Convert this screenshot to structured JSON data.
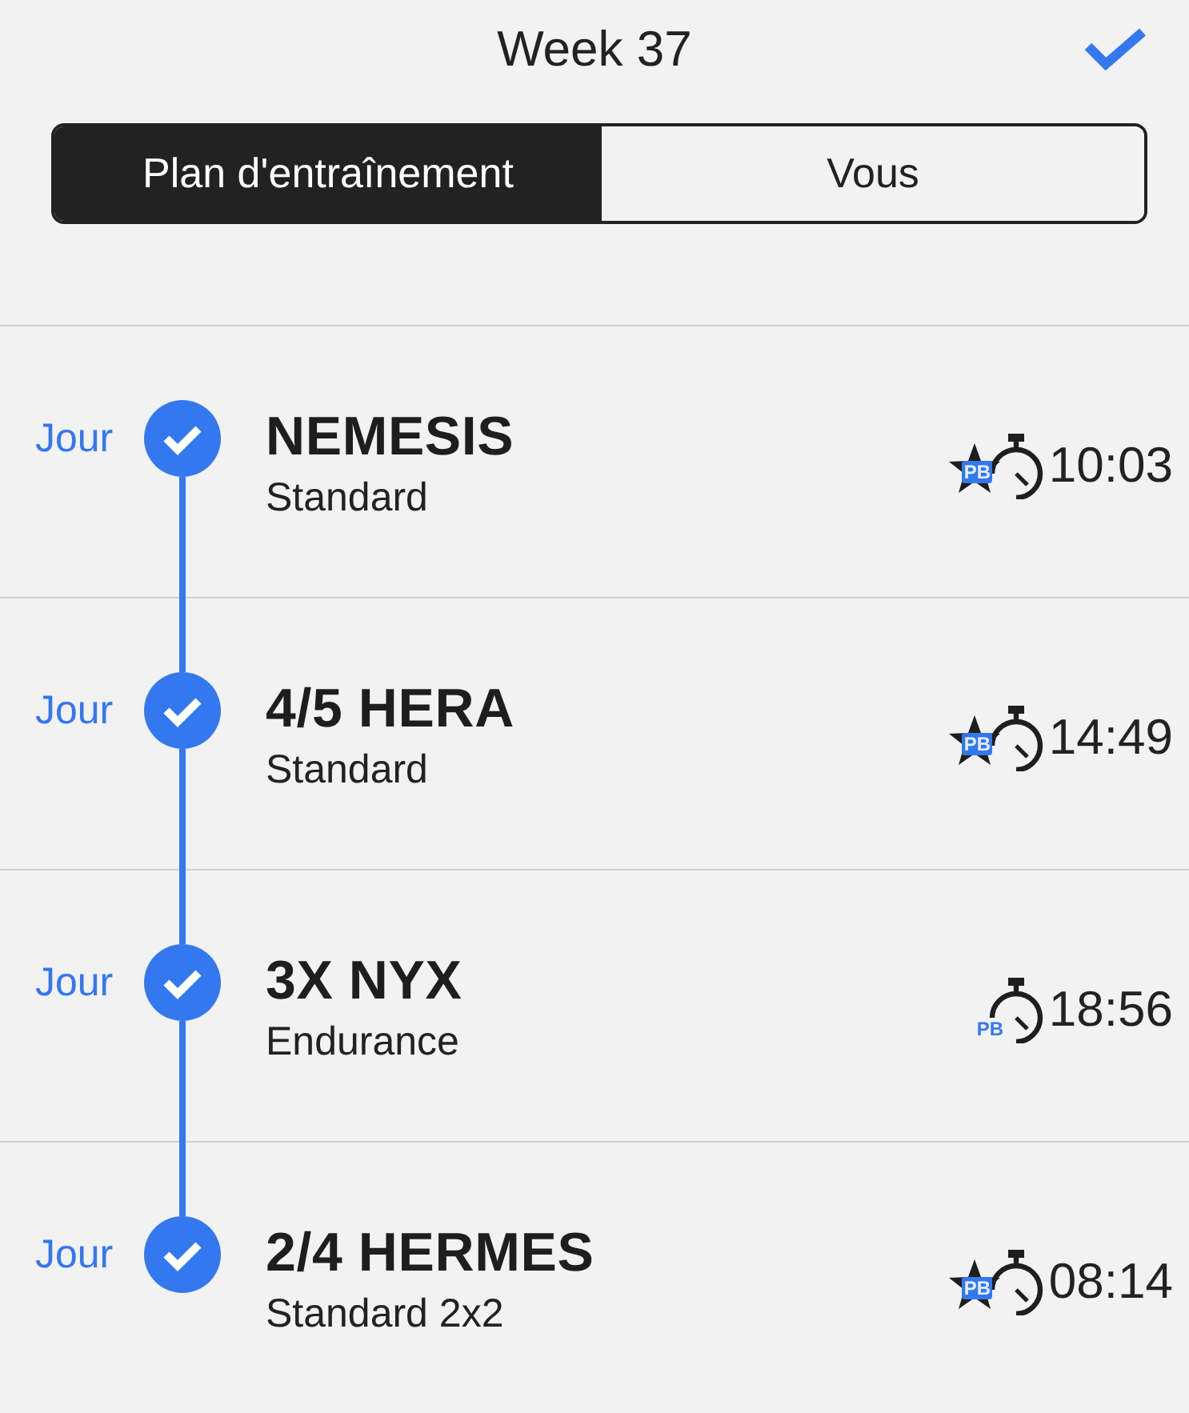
{
  "header": {
    "title": "Week 37"
  },
  "tabs": [
    {
      "label": "Plan d'entraînement",
      "selected": true
    },
    {
      "label": "Vous",
      "selected": false
    }
  ],
  "workouts": [
    {
      "day": "Jour",
      "title": "NEMESIS",
      "subtitle": "Standard",
      "done": true,
      "starred": true,
      "badge": "PB",
      "time": "10:03"
    },
    {
      "day": "Jour",
      "title": "4/5 HERA",
      "subtitle": "Standard",
      "done": true,
      "starred": true,
      "badge": "PB",
      "time": "14:49"
    },
    {
      "day": "Jour",
      "title": "3X NYX",
      "subtitle": "Endurance",
      "done": true,
      "starred": false,
      "badge": "PB",
      "time": "18:56"
    },
    {
      "day": "Jour",
      "title": "2/4 HERMES",
      "subtitle": "Standard 2x2",
      "done": true,
      "starred": true,
      "badge": "PB",
      "time": "08:14"
    }
  ]
}
